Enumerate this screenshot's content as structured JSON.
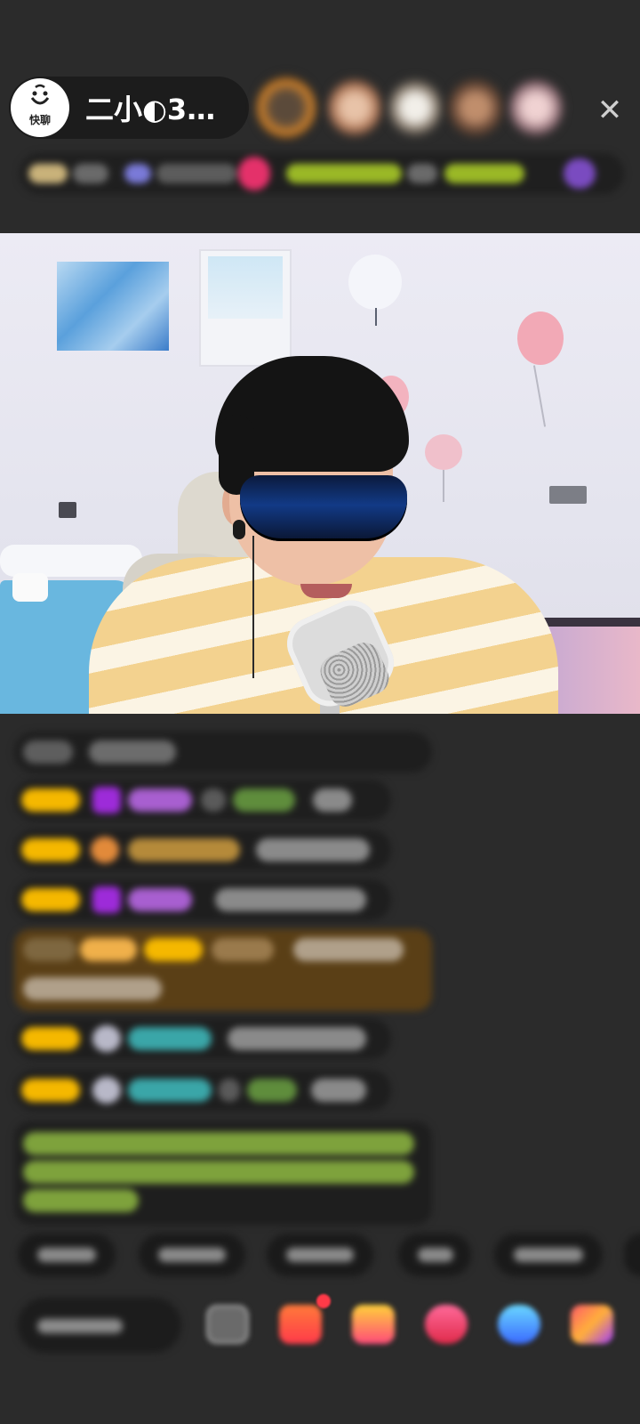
{
  "header": {
    "app_logo": {
      "brand_text": "快聊",
      "icon": "smiley-logo-icon"
    },
    "streamer_name": "二小◐3…",
    "close_icon": "close-icon",
    "viewer_avatar_count": 5
  },
  "video": {
    "description_icon": "live-video-feed"
  },
  "chat": {
    "message_count": 9
  },
  "quick_replies": {
    "count": 6
  },
  "toolbar": {
    "icons": [
      "emoji-icon",
      "gift-box-icon",
      "treasure-icon",
      "heart-gift-icon",
      "game-icon",
      "more-apps-icon"
    ]
  },
  "colors": {
    "background": "#2b2b2b",
    "level_badge": "#f5b800",
    "highlight_message": "#5a3f16",
    "purple_gem": "#9d2bd9",
    "system_text": "#8fd14f"
  }
}
